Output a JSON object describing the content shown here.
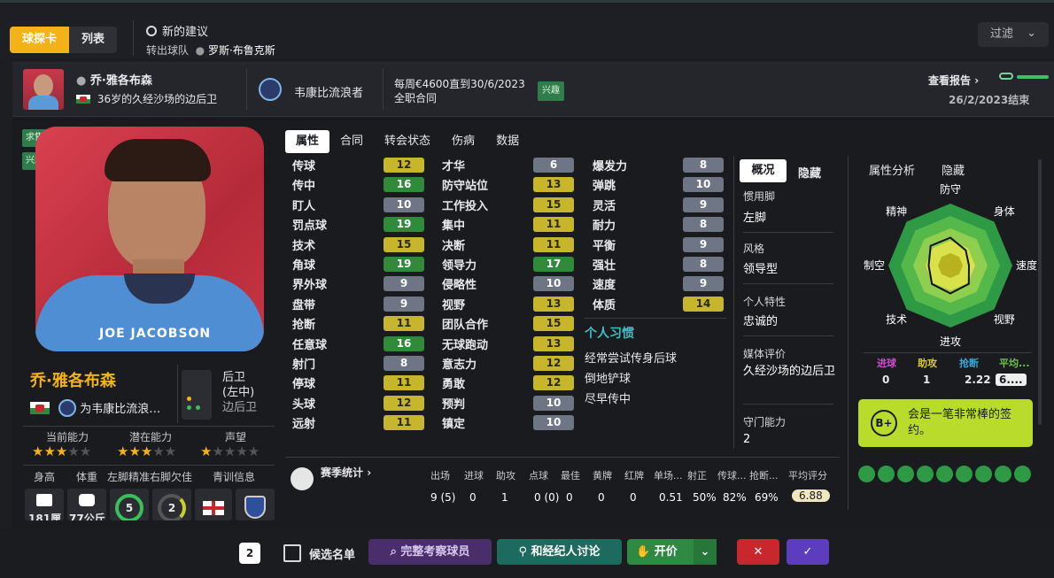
{
  "topbar": {
    "tab_card": "球探卡",
    "tab_list": "列表",
    "suggestion_title": "新的建议",
    "transfer_label": "转出球队",
    "transfer_player": "罗斯·布鲁克斯",
    "filter_label": "过滤"
  },
  "player": {
    "name": "乔·雅各布森",
    "description": "36岁的久经沙场的边后卫",
    "club": "韦康比流浪者",
    "contract_line1": "每周€4600直到30/6/2023",
    "contract_line2": "全职合同",
    "interest_badge": "兴趣",
    "report_link": "查看报告",
    "report_end": "26/2/2023结束",
    "for_club": "为韦康比流浪…",
    "position_line1": "后卫",
    "position_line2": "(左中)",
    "position_line3": "边后卫",
    "shirt_name": "JOE JACOBSON",
    "tag_sale": "求售",
    "tag_interest": "兴趣"
  },
  "ratings": {
    "current_label": "当前能力",
    "potential_label": "潜在能力",
    "reputation_label": "声望",
    "current_stars": 2.5,
    "potential_stars": 2.5,
    "reputation_stars": 1.5
  },
  "physical": {
    "height_label": "身高",
    "weight_label": "体重",
    "left_foot_label": "左脚精准",
    "right_foot_label": "右脚欠佳",
    "youth_label": "青训信息",
    "height_value": "181厘",
    "weight_value": "77公斤",
    "left_foot_value": "5",
    "right_foot_value": "2"
  },
  "main_tabs": [
    "属性",
    "合同",
    "转会状态",
    "伤病",
    "数据"
  ],
  "attributes_col1": [
    {
      "name": "传球",
      "value": "12",
      "color": "olive"
    },
    {
      "name": "传中",
      "value": "16",
      "color": "green"
    },
    {
      "name": "盯人",
      "value": "10",
      "color": "gray"
    },
    {
      "name": "罚点球",
      "value": "19",
      "color": "green"
    },
    {
      "name": "技术",
      "value": "15",
      "color": "olive"
    },
    {
      "name": "角球",
      "value": "19",
      "color": "green"
    },
    {
      "name": "界外球",
      "value": "9",
      "color": "gray"
    },
    {
      "name": "盘带",
      "value": "9",
      "color": "gray"
    },
    {
      "name": "抢断",
      "value": "11",
      "color": "olive"
    },
    {
      "name": "任意球",
      "value": "16",
      "color": "green"
    },
    {
      "name": "射门",
      "value": "8",
      "color": "gray"
    },
    {
      "name": "停球",
      "value": "11",
      "color": "olive"
    },
    {
      "name": "头球",
      "value": "12",
      "color": "olive"
    },
    {
      "name": "远射",
      "value": "11",
      "color": "olive"
    }
  ],
  "attributes_col2": [
    {
      "name": "才华",
      "value": "6",
      "color": "gray"
    },
    {
      "name": "防守站位",
      "value": "13",
      "color": "olive"
    },
    {
      "name": "工作投入",
      "value": "15",
      "color": "olive"
    },
    {
      "name": "集中",
      "value": "11",
      "color": "olive"
    },
    {
      "name": "决断",
      "value": "11",
      "color": "olive"
    },
    {
      "name": "领导力",
      "value": "17",
      "color": "green"
    },
    {
      "name": "侵略性",
      "value": "10",
      "color": "gray"
    },
    {
      "name": "视野",
      "value": "13",
      "color": "olive"
    },
    {
      "name": "团队合作",
      "value": "15",
      "color": "olive"
    },
    {
      "name": "无球跑动",
      "value": "13",
      "color": "olive"
    },
    {
      "name": "意志力",
      "value": "12",
      "color": "olive"
    },
    {
      "name": "勇敢",
      "value": "12",
      "color": "olive"
    },
    {
      "name": "预判",
      "value": "10",
      "color": "gray"
    },
    {
      "name": "镇定",
      "value": "10",
      "color": "gray"
    }
  ],
  "attributes_col3": [
    {
      "name": "爆发力",
      "value": "8",
      "color": "gray"
    },
    {
      "name": "弹跳",
      "value": "10",
      "color": "gray"
    },
    {
      "name": "灵活",
      "value": "9",
      "color": "gray"
    },
    {
      "name": "耐力",
      "value": "8",
      "color": "gray"
    },
    {
      "name": "平衡",
      "value": "9",
      "color": "gray"
    },
    {
      "name": "强壮",
      "value": "8",
      "color": "gray"
    },
    {
      "name": "速度",
      "value": "9",
      "color": "gray"
    },
    {
      "name": "体质",
      "value": "14",
      "color": "olive"
    }
  ],
  "habits": {
    "title": "个人习惯",
    "items": [
      "经常尝试传身后球",
      "倒地铲球",
      "尽早传中"
    ]
  },
  "overview": {
    "tab_overview": "概况",
    "tab_hide": "隐藏",
    "foot_label": "惯用脚",
    "foot_value": "左脚",
    "style_label": "风格",
    "style_value": "领导型",
    "personality_label": "个人特性",
    "personality_value": "忠诚的",
    "media_label": "媒体评价",
    "media_value": "久经沙场的边后卫",
    "gk_label": "守门能力",
    "gk_value": "2"
  },
  "radar": {
    "title": "属性分析",
    "hide": "隐藏",
    "labels": [
      "防守",
      "身体",
      "速度",
      "视野",
      "进攻",
      "技术",
      "制空",
      "精神"
    ],
    "values": [
      0.45,
      0.35,
      0.3,
      0.42,
      0.45,
      0.42,
      0.35,
      0.45
    ]
  },
  "mini_stats": {
    "headers": [
      "进球",
      "助攻",
      "抢断",
      "平均..."
    ],
    "values": [
      "0",
      "1",
      "2.22",
      "6...."
    ],
    "header_colors": [
      "#d14bd0",
      "#d8c92c",
      "#3aa8d8",
      "#6cc14a"
    ]
  },
  "recommendation": {
    "grade": "B+",
    "text": "会是一笔非常棒的签约。"
  },
  "season": {
    "title": "赛季统计",
    "headers": [
      "出场",
      "进球",
      "助攻",
      "点球",
      "最佳",
      "黄牌",
      "红牌",
      "单场...",
      "射正",
      "传球...",
      "抢断...",
      "平均评分"
    ],
    "values": [
      "9 (5)",
      "0",
      "1",
      "0 (0)",
      "0",
      "0",
      "0",
      "0.51",
      "50%",
      "82%",
      "69%",
      "6.88"
    ]
  },
  "bottom": {
    "count": "2",
    "shortlist": "候选名单",
    "full_scout": "完整考察球员",
    "agent": "和经纪人讨论",
    "offer": "开价"
  },
  "colors": {
    "accent": "#f3b318",
    "green_value": "#2f8a3a",
    "olive_value": "#c7b62c",
    "gray_value": "#6e7686",
    "purple": "#5b3dbd",
    "red": "#c8272d",
    "teal": "#1d6b5e",
    "recommend_bg": "#b9dc2c"
  }
}
